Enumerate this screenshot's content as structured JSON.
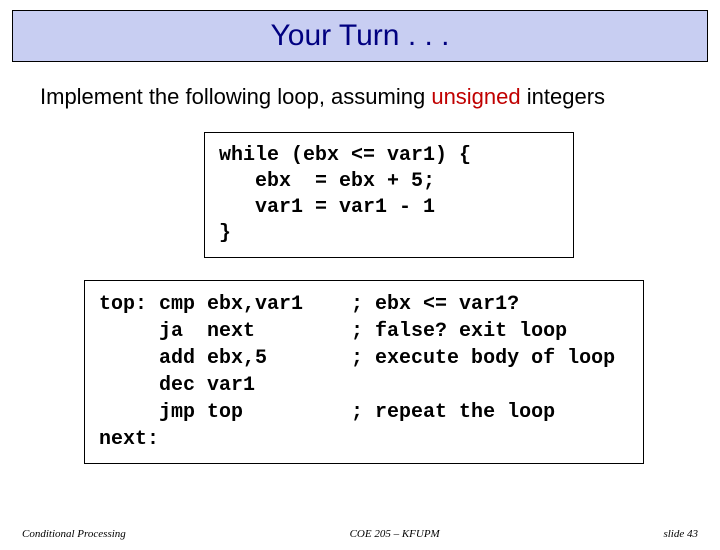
{
  "title": "Your Turn . . .",
  "subtitle_before": "Implement the following loop, assuming ",
  "subtitle_unsigned": "unsigned",
  "subtitle_after": " integers",
  "pseudocode": "while (ebx <= var1) {\n   ebx  = ebx + 5;\n   var1 = var1 - 1\n}",
  "asm": "top: cmp ebx,var1    ; ebx <= var1?\n     ja  next        ; false? exit loop\n     add ebx,5       ; execute body of loop\n     dec var1\n     jmp top         ; repeat the loop\nnext:",
  "footer": {
    "left": "Conditional Processing",
    "center": "COE 205 – KFUPM",
    "right": "slide 43"
  }
}
